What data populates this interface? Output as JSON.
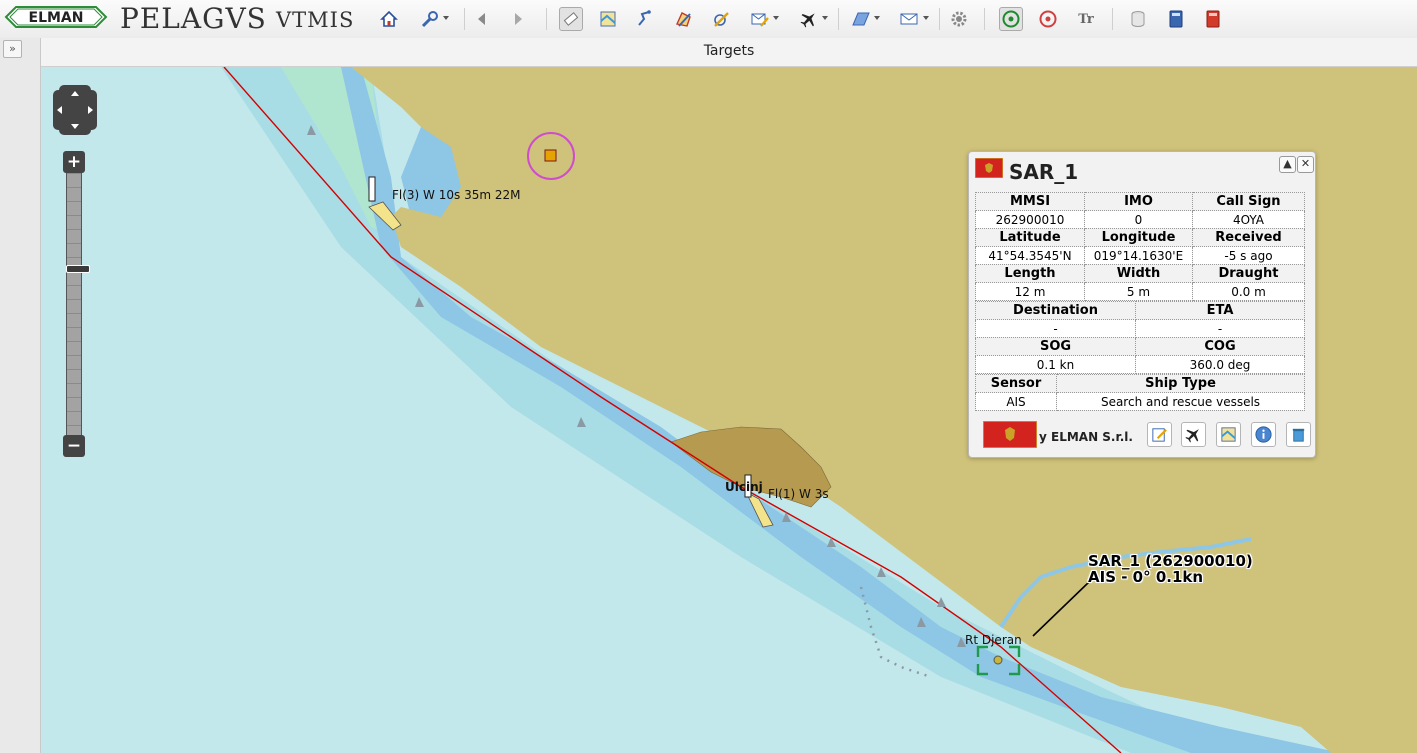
{
  "app": {
    "logo_text": "ELMAN",
    "brand": "PELAGVS",
    "brand_suffix": "VTMIS"
  },
  "toolbar": {
    "buttons": [
      {
        "icon": "home-icon"
      },
      {
        "icon": "tools-icon",
        "dropdown": true
      },
      {
        "icon": "back-arrow-icon"
      },
      {
        "icon": "forward-arrow-icon"
      },
      {
        "icon": "eraser-icon",
        "active": true
      },
      {
        "icon": "chart-layer-icon"
      },
      {
        "icon": "route-icon"
      },
      {
        "icon": "area-edit-icon"
      },
      {
        "icon": "measure-icon"
      },
      {
        "icon": "message-edit-icon",
        "dropdown": true
      },
      {
        "icon": "aircraft-icon",
        "dropdown": true
      },
      {
        "icon": "polygon-icon",
        "dropdown": true
      },
      {
        "icon": "mail-icon",
        "dropdown": true
      },
      {
        "icon": "settings-icon"
      },
      {
        "icon": "radar-green-icon"
      },
      {
        "icon": "radar-red-icon"
      },
      {
        "icon": "text-size-icon",
        "text": "Tr"
      },
      {
        "icon": "database-icon"
      },
      {
        "icon": "book-blue-icon"
      },
      {
        "icon": "book-red-icon"
      }
    ]
  },
  "panel": {
    "title": "Targets",
    "expand_glyph": "»"
  },
  "map": {
    "labels": {
      "lighthouse_1": "Fl(3) W 10s 35m 22M",
      "town": "Ulcinj",
      "lighthouse_2": "Fl(1) W 3s",
      "point": "Rt Djeran"
    },
    "ship_label": {
      "line1": "SAR_1 (262900010)",
      "line2": "AIS - 0° 0.1kn"
    },
    "colors": {
      "land": "#cfc27a",
      "shallow": "#8ec6e6",
      "medium": "#a9dbe6",
      "deep": "#c2e8ec",
      "green_shallow": "#b0e6cf",
      "town": "#b59a4f",
      "route": "#d40000"
    }
  },
  "popup": {
    "title": "SAR_1",
    "footer_text": "y ELMAN S.r.l.",
    "table1": [
      [
        "MMSI",
        "IMO",
        "Call Sign"
      ],
      [
        "262900010",
        "0",
        "4OYA"
      ],
      [
        "Latitude",
        "Longitude",
        "Received"
      ],
      [
        "41°54.3545'N",
        "019°14.1630'E",
        "-5 s ago"
      ],
      [
        "Length",
        "Width",
        "Draught"
      ],
      [
        "12 m",
        "5 m",
        "0.0 m"
      ]
    ],
    "table2": [
      [
        "Destination",
        "ETA"
      ],
      [
        "-",
        "-"
      ],
      [
        "SOG",
        "COG"
      ],
      [
        "0.1 kn",
        "360.0 deg"
      ]
    ],
    "table3": [
      [
        "Sensor",
        "Ship Type"
      ],
      [
        "AIS",
        "Search and rescue vessels"
      ]
    ],
    "footer_buttons": [
      "edit-note-icon",
      "aircraft-icon",
      "chart-icon",
      "info-icon",
      "trash-icon"
    ]
  }
}
